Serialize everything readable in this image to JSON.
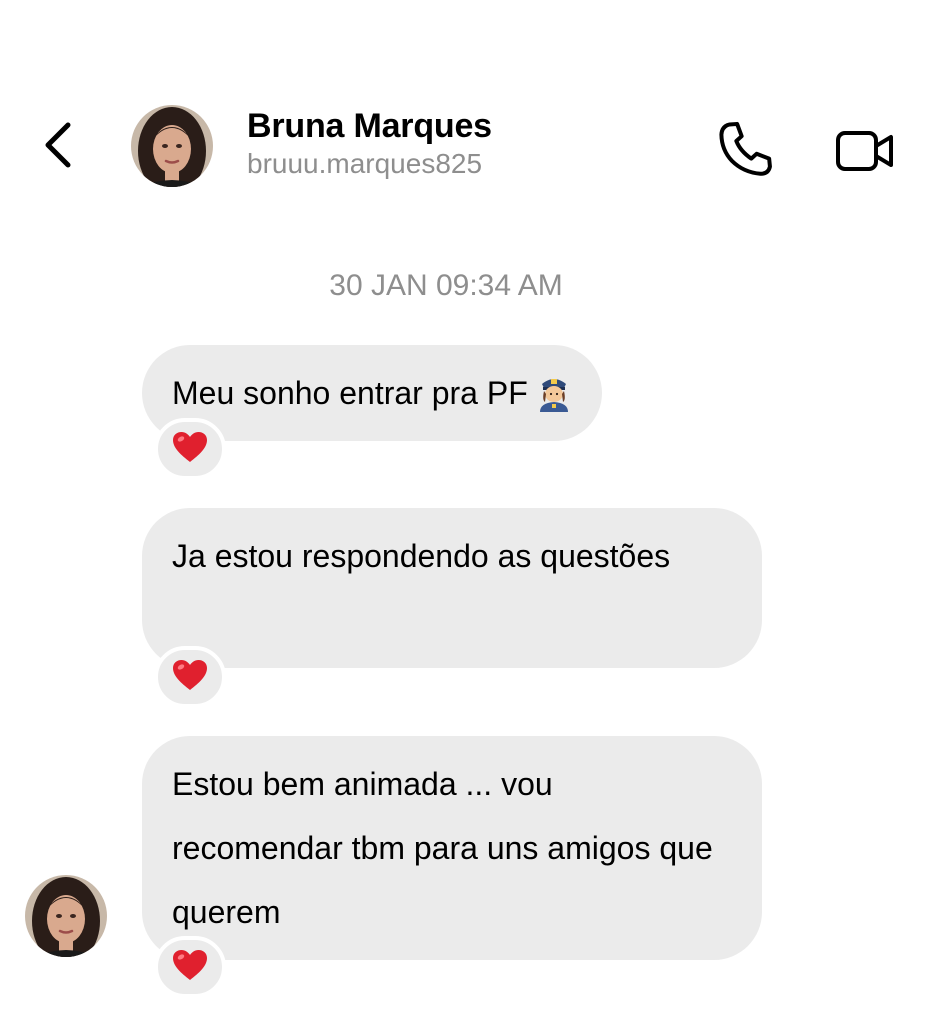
{
  "header": {
    "contact_name": "Bruna Marques",
    "contact_handle": "bruuu.marques825",
    "icons": {
      "back": "chevron-left-icon",
      "call": "phone-icon",
      "video": "video-camera-icon"
    }
  },
  "thread": {
    "timestamp": "30 JAN 09:34 AM",
    "messages": [
      {
        "text": "Meu sonho entrar pra PF",
        "emoji": "police-officer-woman-icon",
        "reaction": "heart"
      },
      {
        "text": "Ja estou respondendo as questões",
        "reaction": "heart"
      },
      {
        "text": "Estou bem animada ... vou recomendar tbm para uns amigos que querem",
        "reaction": "heart"
      }
    ]
  },
  "colors": {
    "bubble_bg": "#ebebeb",
    "secondary_text": "#8e8e8e",
    "heart": "#e0202e"
  }
}
